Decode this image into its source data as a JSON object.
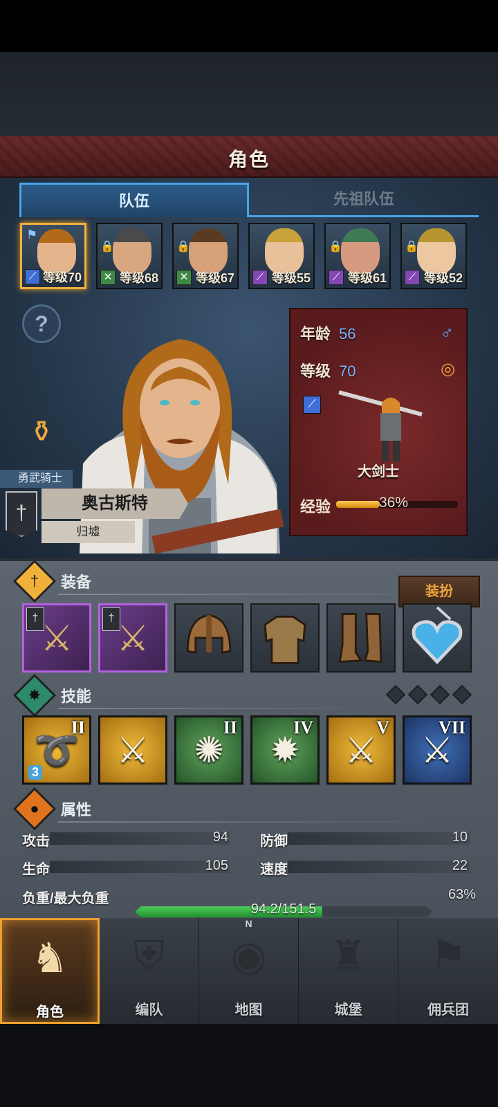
{
  "header": {
    "title": "角色"
  },
  "tabs": [
    {
      "label": "队伍",
      "active": true
    },
    {
      "label": "先祖队伍",
      "active": false
    }
  ],
  "team": [
    {
      "level_text": "等级70",
      "class_icon": "sword-class-icon",
      "class_color": "#3f6fd6",
      "selected": true,
      "hair": "#b06a1a",
      "skin": "#e4b48c"
    },
    {
      "level_text": "等级68",
      "class_icon": "crossed-axes-class-icon",
      "class_color": "#3d8a47",
      "selected": false,
      "hair": "#4a4a4a",
      "skin": "#d8a67f"
    },
    {
      "level_text": "等级67",
      "class_icon": "crossed-axes-class-icon",
      "class_color": "#3d8a47",
      "selected": false,
      "hair": "#5a3a22",
      "skin": "#d6a078"
    },
    {
      "level_text": "等级55",
      "class_icon": "staff-class-icon",
      "class_color": "#8348b5",
      "selected": false,
      "hair": "#c9a23a",
      "skin": "#e8c09a"
    },
    {
      "level_text": "等级61",
      "class_icon": "staff-class-icon",
      "class_color": "#8348b5",
      "selected": false,
      "hair": "#3f7a55",
      "skin": "#d69a80"
    },
    {
      "level_text": "等级52",
      "class_icon": "staff-class-icon",
      "class_color": "#8348b5",
      "selected": false,
      "hair": "#b8962f",
      "skin": "#ecc7a0"
    }
  ],
  "character": {
    "title": "勇武骑士",
    "name": "奥古斯特",
    "origin": "归墟",
    "age_label": "年龄",
    "age": "56",
    "level_label": "等级",
    "level": "70",
    "class_name": "大剑士",
    "exp_label": "经验",
    "exp_percent_text": "36%",
    "exp_fraction": 0.36,
    "gender_icon": "male-icon"
  },
  "equipment": {
    "title": "装备",
    "dress_button": "装扮",
    "slots": [
      {
        "icon": "crossed-swords-icon",
        "kind": "weapon"
      },
      {
        "icon": "crossed-swords-icon",
        "kind": "weapon"
      },
      {
        "icon": "helmet-icon",
        "kind": "gear"
      },
      {
        "icon": "armor-icon",
        "kind": "gear"
      },
      {
        "icon": "boots-icon",
        "kind": "gear"
      },
      {
        "icon": "heart-amulet-icon",
        "kind": "gear"
      }
    ]
  },
  "skills": {
    "title": "技能",
    "items": [
      {
        "icon": "whirlwind-icon",
        "rank": "II",
        "color": "gold",
        "stack": "3"
      },
      {
        "icon": "sword-aura-icon",
        "rank": "",
        "color": "gold",
        "stack": ""
      },
      {
        "icon": "crystal-burst-icon",
        "rank": "II",
        "color": "green",
        "stack": ""
      },
      {
        "icon": "starburst-icon",
        "rank": "IV",
        "color": "green",
        "stack": ""
      },
      {
        "icon": "crossed-blades-icon",
        "rank": "V",
        "color": "gold",
        "stack": ""
      },
      {
        "icon": "crossed-blades-icon",
        "rank": "VII",
        "color": "blue",
        "stack": ""
      }
    ]
  },
  "attributes": {
    "title": "属性",
    "attack_label": "攻击",
    "attack": "94",
    "defense_label": "防御",
    "defense": "10",
    "hp_label": "生命",
    "hp": "105",
    "speed_label": "速度",
    "speed": "22",
    "load_label": "负重/最大负重",
    "load_text": "94.2/151.5",
    "load_fraction": 0.63,
    "load_percent_text": "63%"
  },
  "nav": [
    {
      "label": "角色",
      "icon": "knight-icon",
      "active": true
    },
    {
      "label": "编队",
      "icon": "formation-icon",
      "active": false
    },
    {
      "label": "地图",
      "icon": "compass-map-icon",
      "active": false,
      "compass_n": "N"
    },
    {
      "label": "城堡",
      "icon": "castle-icon",
      "active": false
    },
    {
      "label": "佣兵团",
      "icon": "mercenary-banner-icon",
      "active": false
    }
  ]
}
